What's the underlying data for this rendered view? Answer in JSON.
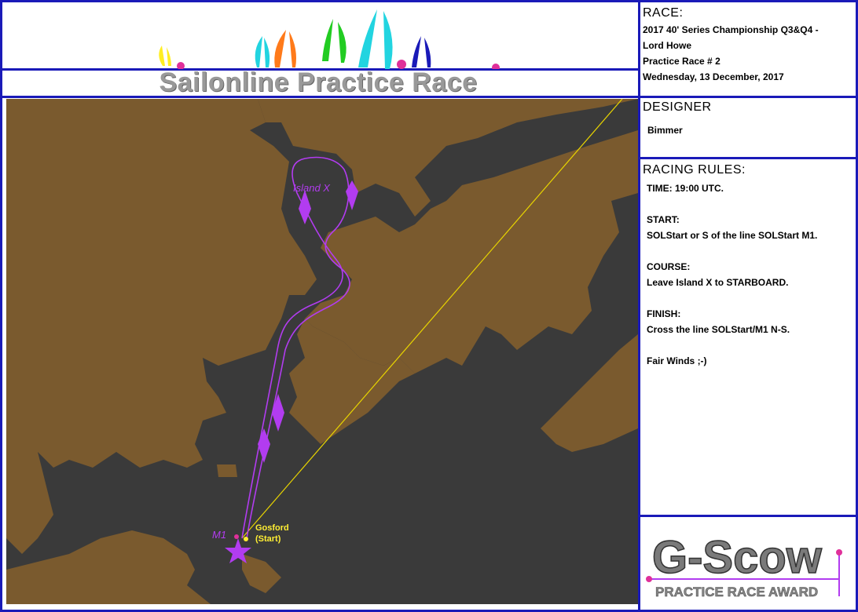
{
  "banner": {
    "title": "Sailonline Practice Race"
  },
  "race": {
    "heading": "RACE:",
    "lines": [
      "2017 40' Series Championship Q3&Q4 -",
      "Lord Howe",
      "Practice Race # 2",
      "Wednesday, 13 December, 2017"
    ]
  },
  "designer": {
    "heading": "DESIGNER",
    "name": "Bimmer"
  },
  "rules": {
    "heading": "RACING RULES:",
    "lines": [
      "TIME: 19:00 UTC.",
      "",
      "START:",
      "SOLStart or S of the line SOLStart M1.",
      "",
      "COURSE:",
      "Leave Island X to STARBOARD.",
      "",
      "FINISH:",
      "Cross the line SOLStart/M1 N-S.",
      "",
      "Fair Winds ;-)"
    ]
  },
  "map": {
    "island_label": "Island X",
    "mark_label": "M1",
    "start_label_1": "Gosford",
    "start_label_2": "(Start)",
    "colors": {
      "land": "#7a5a2e",
      "water": "#3a3a3a",
      "route": "#b23cf0",
      "rhumb_line": "#e8d400",
      "label_yellow": "#ffee33"
    }
  },
  "award": {
    "logo_text": "G-Scow",
    "subtitle": "PRACTICE RACE AWARD"
  }
}
